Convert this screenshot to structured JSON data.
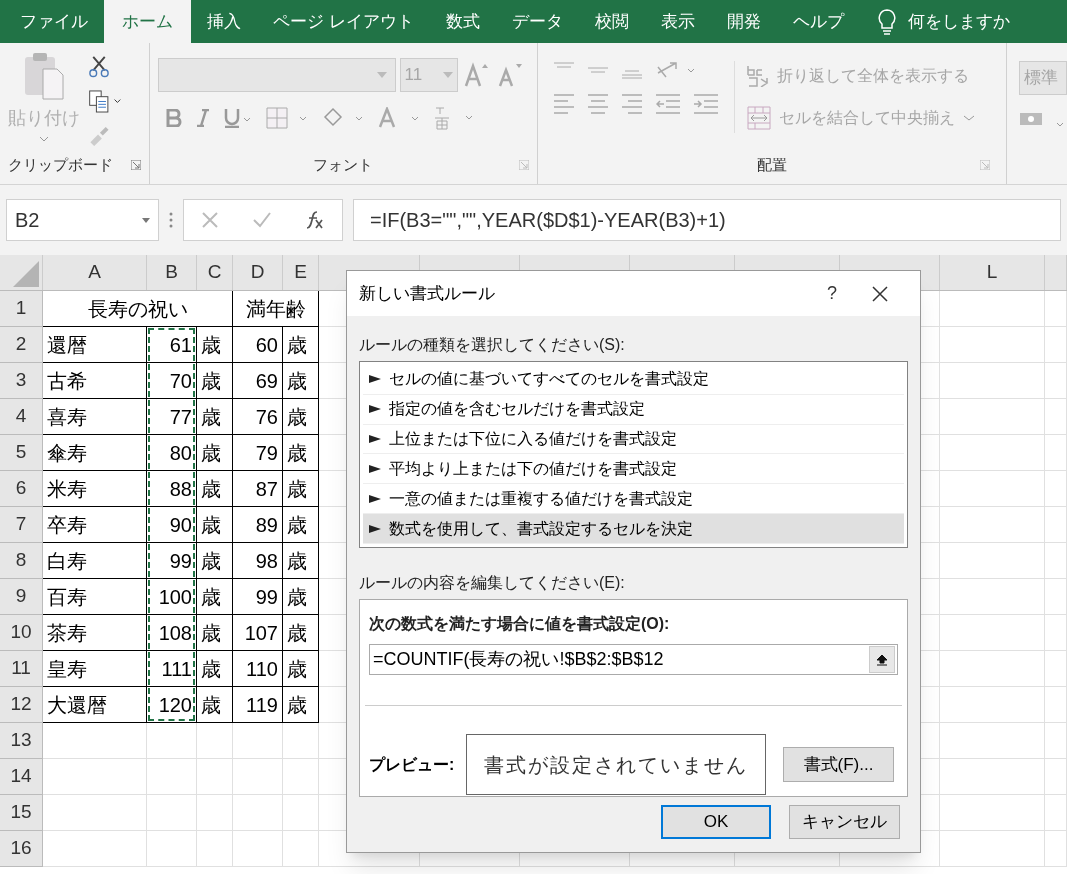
{
  "ribbon_tabs": [
    {
      "label": "ファイル",
      "selected": false
    },
    {
      "label": "ホーム",
      "selected": true
    },
    {
      "label": "挿入",
      "selected": false
    },
    {
      "label": "ページ レイアウト",
      "selected": false
    },
    {
      "label": "数式",
      "selected": false
    },
    {
      "label": "データ",
      "selected": false
    },
    {
      "label": "校閲",
      "selected": false
    },
    {
      "label": "表示",
      "selected": false
    },
    {
      "label": "開発",
      "selected": false
    },
    {
      "label": "ヘルプ",
      "selected": false
    }
  ],
  "tell_me": "何をしますか",
  "ribbon": {
    "clipboard": {
      "paste": "貼り付け",
      "group_label": "クリップボード"
    },
    "font": {
      "font_size": "11",
      "group_label": "フォント"
    },
    "alignment": {
      "wrap_text": "折り返して全体を表示する",
      "merge_center": "セルを結合して中央揃え",
      "group_label": "配置"
    },
    "number": {
      "format": "標準"
    }
  },
  "formula_bar": {
    "name_box": "B2",
    "formula": "=IF(B3=\"\",\"\",YEAR($D$1)-YEAR(B3)+1)"
  },
  "sheet": {
    "columns": [
      {
        "label": "A",
        "marquee": false
      },
      {
        "label": "B",
        "marquee": true
      },
      {
        "label": "C",
        "marquee": false
      },
      {
        "label": "D",
        "marquee": false
      },
      {
        "label": "E",
        "marquee": false
      },
      {
        "marquee": false
      },
      {
        "marquee": false
      },
      {
        "marquee": false
      },
      {
        "marquee": false
      },
      {
        "marquee": false
      },
      {
        "marquee": false
      },
      {
        "label": "L",
        "marquee": false
      },
      {
        "marquee": false
      }
    ],
    "title_row": {
      "header": "1",
      "group_title": "長寿の祝い",
      "age_title": "満年齢"
    },
    "rows": [
      {
        "header": "2",
        "cells": [
          "還暦",
          "61",
          "歳",
          "60",
          "歳"
        ]
      },
      {
        "header": "3",
        "cells": [
          "古希",
          "70",
          "歳",
          "69",
          "歳"
        ]
      },
      {
        "header": "4",
        "cells": [
          "喜寿",
          "77",
          "歳",
          "76",
          "歳"
        ]
      },
      {
        "header": "5",
        "cells": [
          "傘寿",
          "80",
          "歳",
          "79",
          "歳"
        ]
      },
      {
        "header": "6",
        "cells": [
          "米寿",
          "88",
          "歳",
          "87",
          "歳"
        ]
      },
      {
        "header": "7",
        "cells": [
          "卒寿",
          "90",
          "歳",
          "89",
          "歳"
        ]
      },
      {
        "header": "8",
        "cells": [
          "白寿",
          "99",
          "歳",
          "98",
          "歳"
        ]
      },
      {
        "header": "9",
        "cells": [
          "百寿",
          "100",
          "歳",
          "99",
          "歳"
        ]
      },
      {
        "header": "10",
        "cells": [
          "茶寿",
          "108",
          "歳",
          "107",
          "歳"
        ]
      },
      {
        "header": "11",
        "cells": [
          "皇寿",
          "111",
          "歳",
          "110",
          "歳"
        ]
      },
      {
        "header": "12",
        "cells": [
          "大還暦",
          "120",
          "歳",
          "119",
          "歳"
        ]
      },
      {
        "header": "13",
        "cells": []
      },
      {
        "header": "14",
        "cells": []
      },
      {
        "header": "15",
        "cells": []
      },
      {
        "header": "16",
        "cells": []
      }
    ]
  },
  "dialog": {
    "title": "新しい書式ルール",
    "help": "?",
    "rule_type_label": "ルールの種類を選択してください(S):",
    "rule_types": [
      {
        "label": "セルの値に基づいてすべてのセルを書式設定",
        "selected": false
      },
      {
        "label": "指定の値を含むセルだけを書式設定",
        "selected": false
      },
      {
        "label": "上位または下位に入る値だけを書式設定",
        "selected": false
      },
      {
        "label": "平均より上または下の値だけを書式設定",
        "selected": false
      },
      {
        "label": "一意の値または重複する値だけを書式設定",
        "selected": false
      },
      {
        "label": "数式を使用して、書式設定するセルを決定",
        "selected": true
      }
    ],
    "edit_label": "ルールの内容を編集してください(E):",
    "formula_label": "次の数式を満たす場合に値を書式設定(O):",
    "formula": "=COUNTIF(長寿の祝い!$B$2:$B$12",
    "preview_label": "プレビュー:",
    "preview_text": "書式が設定されていません",
    "format_button": "書式(F)...",
    "ok": "OK",
    "cancel": "キャンセル"
  }
}
